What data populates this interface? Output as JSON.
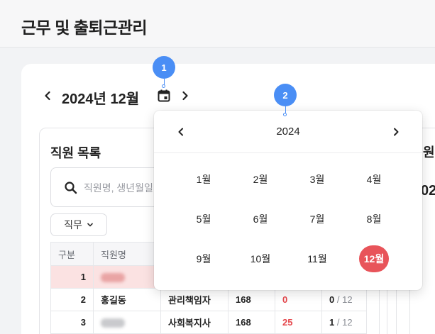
{
  "app": {
    "title": "근무 및 출퇴근관리"
  },
  "month_nav": {
    "label": "2024년 12월"
  },
  "employee_panel": {
    "title": "직원 목록",
    "search_placeholder": "직원명, 생년월일",
    "filter_label": "직무",
    "columns": [
      "구분",
      "직원명"
    ],
    "rows": [
      {
        "no": "1",
        "name": "",
        "role": "",
        "hours": "",
        "count": "",
        "done": "",
        "total": ""
      },
      {
        "no": "2",
        "name": "홍길동",
        "role": "관리책임자",
        "hours": "168",
        "count": "0",
        "done": "0",
        "total": "/ 12"
      },
      {
        "no": "3",
        "name": "",
        "role": "사회복지사",
        "hours": "168",
        "count": "25",
        "done": "1",
        "total": "/ 12"
      }
    ]
  },
  "right_panel": {
    "title_fragment": "원",
    "value_fragment": "02"
  },
  "year_picker": {
    "year": "2024",
    "months": [
      "1월",
      "2월",
      "3월",
      "4월",
      "5월",
      "6월",
      "7월",
      "8월",
      "9월",
      "10월",
      "11월",
      "12월"
    ],
    "selected": "12월"
  },
  "markers": [
    "1",
    "2"
  ],
  "colors": {
    "accent_red": "#e8545a",
    "marker_blue": "#4a8ef5",
    "row_highlight": "#fbe2e2"
  },
  "icons": [
    "chevron-left-icon",
    "chevron-right-icon",
    "calendar-icon",
    "search-icon",
    "chevron-down-icon"
  ]
}
